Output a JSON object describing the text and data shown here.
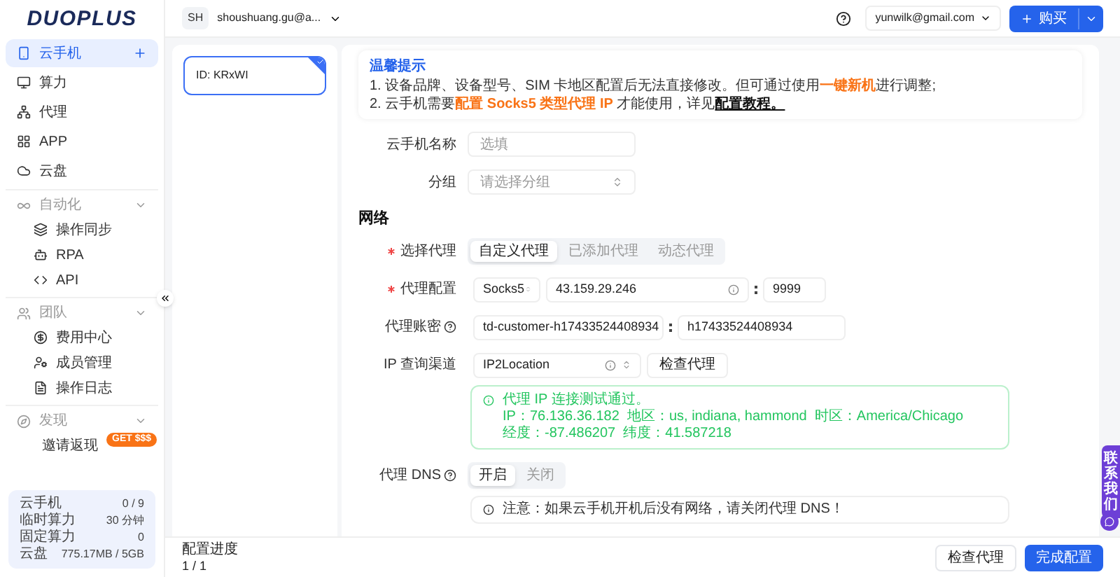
{
  "logo": "DUOPLUS",
  "header": {
    "avatar": "SH",
    "account": "shoushuang.gu@a...",
    "user": "yunwilk@gmail.com",
    "buy_button": "购买"
  },
  "sidebar": {
    "items": [
      {
        "kind": "item",
        "label": "云手机",
        "selected": true
      },
      {
        "kind": "item",
        "label": "算力",
        "selected": false
      },
      {
        "kind": "item",
        "label": "代理",
        "selected": false
      },
      {
        "kind": "item",
        "label": "APP",
        "selected": false
      },
      {
        "kind": "item",
        "label": "云盘",
        "selected": false
      },
      {
        "kind": "section",
        "label": "自动化",
        "expanded": true,
        "children": [
          {
            "label": "操作同步"
          },
          {
            "label": "RPA"
          },
          {
            "label": "API"
          }
        ]
      },
      {
        "kind": "section",
        "label": "团队",
        "expanded": true,
        "children": [
          {
            "label": "费用中心"
          },
          {
            "label": "成员管理"
          },
          {
            "label": "操作日志"
          }
        ]
      },
      {
        "kind": "section",
        "label": "发现",
        "expanded": true,
        "children": [
          {
            "label": "邀请返现",
            "badge": "GET $$$"
          }
        ]
      }
    ],
    "stats": [
      {
        "label": "云手机",
        "value": "0 / 9"
      },
      {
        "label": "临时算力",
        "value": "30 分钟"
      },
      {
        "label": "固定算力",
        "value": "0"
      },
      {
        "label": "云盘",
        "value": "775.17MB / 5GB"
      }
    ]
  },
  "devices": [
    {
      "id": "ID: KRxWI",
      "selected": true
    }
  ],
  "notice": {
    "title": "温馨提示",
    "lines": [
      [
        {
          "kind": "text",
          "text": "1. 设备品牌、设备型号、SIM 卡地区配置后无法直接修改。但可通过使用"
        },
        {
          "kind": "highlight",
          "text": "一键新机"
        },
        {
          "kind": "text",
          "text": "进行调整;"
        }
      ],
      [
        {
          "kind": "text",
          "text": "2. 云手机需要"
        },
        {
          "kind": "highlight",
          "text": "配置 Socks5 类型代理 IP"
        },
        {
          "kind": "text",
          "text": " 才能使用，详见"
        },
        {
          "kind": "link",
          "text": "配置教程。"
        }
      ]
    ]
  },
  "form": {
    "name": {
      "label": "云手机名称",
      "placeholder": "选填"
    },
    "group": {
      "label": "分组",
      "placeholder": "请选择分组"
    },
    "section_title": "网络",
    "proxy_type": {
      "label": "选择代理",
      "required": true,
      "options": [
        {
          "label": "自定义代理",
          "selected": true
        },
        {
          "label": "已添加代理",
          "selected": false
        },
        {
          "label": "动态代理",
          "selected": false
        }
      ]
    },
    "proxy_config": {
      "label": "代理配置",
      "required": true,
      "protocol": "Socks5",
      "host": "43.159.29.246",
      "port": "9999"
    },
    "credentials": {
      "label": "代理账密",
      "username": "td-customer-h17433524408934",
      "password": "h17433524408934"
    },
    "ip_channel": {
      "label": "IP 查询渠道",
      "value": "IP2Location",
      "button": "检查代理"
    },
    "result": {
      "title": "代理 IP 连接测试通过。",
      "lines": [
        "IP：76.136.36.182  地区：us, indiana, hammond  时区：America/Chicago",
        "经度：-87.486207  纬度：41.587218"
      ]
    },
    "dns": {
      "label": "代理 DNS",
      "options": [
        {
          "label": "开启",
          "selected": true
        },
        {
          "label": "关闭",
          "selected": false
        }
      ],
      "note": "注意：如果云手机开机后没有网络，请关闭代理 DNS！"
    }
  },
  "footer": {
    "progress_label": "配置进度",
    "progress": "1 / 1",
    "buttons": [
      {
        "kind": "secondary",
        "label": "检查代理"
      },
      {
        "kind": "primary",
        "label": "完成配置"
      }
    ]
  },
  "contact_tab": "联系我们"
}
